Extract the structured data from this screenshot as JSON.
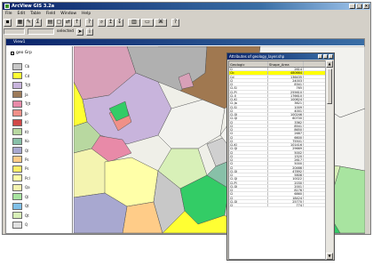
{
  "app": {
    "title": "ArcView GIS 3.2a"
  },
  "menu": [
    "File",
    "Edit",
    "Table",
    "Field",
    "Window",
    "Help"
  ],
  "toolbar2": {
    "selected_text": "selected"
  },
  "view": {
    "title": "View1"
  },
  "toc": {
    "layer_name": "geo Grp",
    "legend": [
      {
        "label": "Cb",
        "color": "#c8c8c8"
      },
      {
        "label": "Cd",
        "color": "#ffff33"
      },
      {
        "label": "TrJt",
        "color": "#c8b4dc"
      },
      {
        "label": "Ja",
        "color": "#9c7a5a"
      },
      {
        "label": "TrJt",
        "color": "#e88aa8"
      },
      {
        "label": "Jp",
        "color": "#f09088"
      },
      {
        "label": "Kl",
        "color": "#d04848"
      },
      {
        "label": "Kt",
        "color": "#b8d8a0"
      },
      {
        "label": "Ko",
        "color": "#88c0a8"
      },
      {
        "label": "Ql",
        "color": "#a8a8d0"
      },
      {
        "label": "Ps",
        "color": "#ffcc88"
      },
      {
        "label": "Ps",
        "color": "#ffee66"
      },
      {
        "label": "Pcl",
        "color": "#ffffa8"
      },
      {
        "label": "Qa",
        "color": "#f4f4b0"
      },
      {
        "label": "Ql",
        "color": "#a8e4a0"
      },
      {
        "label": "Qt",
        "color": "#80c0e8"
      },
      {
        "label": "Qt",
        "color": "#d8f0b8"
      },
      {
        "label": "Q",
        "color": "#e0e0e0"
      }
    ]
  },
  "table": {
    "title": "Attributes of geology_layer.shp",
    "columns": [
      "Geologic",
      "Shape_Area",
      ""
    ],
    "rows": [
      [
        "Q",
        "2614"
      ],
      [
        "Cb",
        "480664"
      ],
      [
        "Cd",
        "136435"
      ],
      [
        "Cl",
        "24003"
      ],
      [
        "Cl",
        "8341"
      ],
      [
        "Cl-Sl",
        "765"
      ],
      [
        "Cl-Pl",
        "255610"
      ],
      [
        "Cl-Jl",
        "176610"
      ],
      [
        "Cl-Kl",
        "100624"
      ],
      [
        "Cl-Ja",
        "3621"
      ],
      [
        "Cl-Sl",
        "1009"
      ],
      [
        "Cl",
        "4001"
      ],
      [
        "Cl-Ql",
        "100246"
      ],
      [
        "Cl-Ql",
        "60700"
      ],
      [
        "Cl",
        "3362"
      ],
      [
        "Cl",
        "8541"
      ],
      [
        "Cl",
        "8650"
      ],
      [
        "Cl",
        "2687"
      ],
      [
        "Cl",
        "6600"
      ],
      [
        "Cl",
        "75501"
      ],
      [
        "Cl-Kl",
        "101416"
      ],
      [
        "Cl-Ql",
        "29669"
      ],
      [
        "Cl",
        "5002"
      ],
      [
        "Cl",
        "1520"
      ],
      [
        "Cl",
        "2617"
      ],
      [
        "Cl",
        "5000"
      ],
      [
        "Cl",
        "20466"
      ],
      [
        "Cl-Ql",
        "47892"
      ],
      [
        "Cl",
        "5808"
      ],
      [
        "Cl-Ql",
        "10022"
      ],
      [
        "Cl-Pl",
        "2030"
      ],
      [
        "Cl-Ql",
        "2001"
      ],
      [
        "Cl",
        "8176"
      ],
      [
        "Cl",
        "6860"
      ],
      [
        "Cl",
        "18424"
      ],
      [
        "Cl-Ql",
        "25770"
      ],
      [
        "Cl",
        "774"
      ]
    ]
  }
}
